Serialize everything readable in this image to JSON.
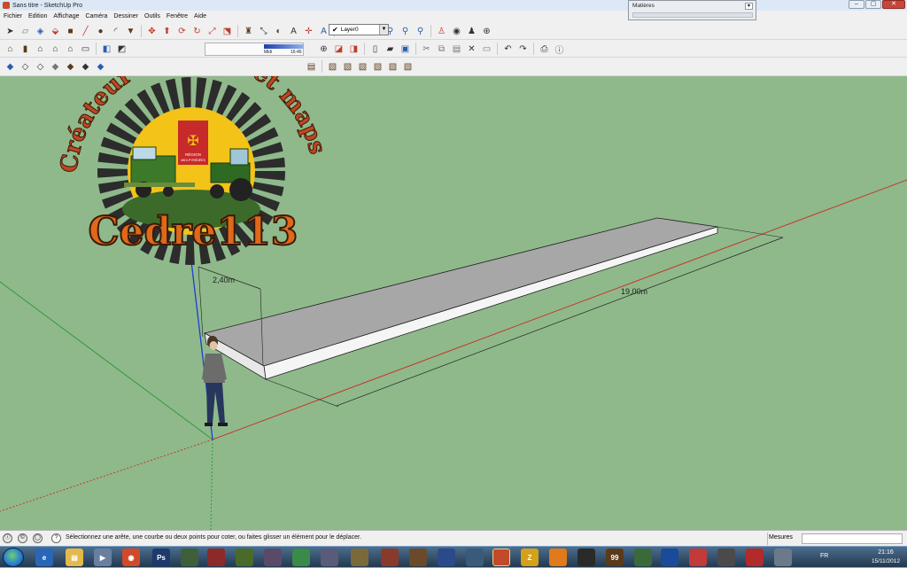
{
  "window": {
    "title": "Sans titre - SketchUp Pro",
    "min": "–",
    "max": "▢",
    "close": "✕"
  },
  "menu": [
    "Fichier",
    "Edition",
    "Affichage",
    "Caméra",
    "Dessiner",
    "Outils",
    "Fenêtre",
    "Aide"
  ],
  "layer": {
    "value": "Layer0",
    "check": "✔"
  },
  "shadow": {
    "noon": "Midi",
    "time": "16:46"
  },
  "materials": {
    "title": "Matières",
    "btn": "▾"
  },
  "dimensions": {
    "width": "2,40m",
    "length": "19,00m"
  },
  "logo": {
    "arc_text": "Créateur de mods et maps",
    "name": "Cedre113",
    "region_line1": "RÉGION",
    "region_line2": "MIDI-PYRÉNÉES"
  },
  "status": {
    "hint_icon": "?",
    "message": "Sélectionnez une arête, une courbe ou deux points pour coter, ou faites glisser un élément pour le déplacer.",
    "measures_label": "Mesures"
  },
  "taskbar": {
    "lang": "FR",
    "time": "21:16",
    "date": "15/11/2012",
    "apps": [
      "e",
      "▤",
      "▶",
      "◉",
      "Ps",
      "",
      "",
      "",
      "",
      "",
      "",
      "",
      "",
      "",
      "",
      "",
      "",
      "",
      "",
      "Z",
      "",
      "",
      "99",
      "",
      "",
      "",
      "",
      "",
      "",
      "",
      ""
    ]
  },
  "icons": {
    "toolbar1": [
      "select-arrow-icon",
      "eraser-icon",
      "make-component-icon",
      "paint-bucket-icon",
      "rectangle-icon",
      "line-icon",
      "circle-icon",
      "arc-icon",
      "polygon-icon",
      "move-icon",
      "push-pull-icon",
      "rotate-icon",
      "follow-me-icon",
      "scale-icon",
      "offset-icon",
      "tape-measure-icon",
      "dimension-icon",
      "protractor-icon",
      "text-icon",
      "axes-icon",
      "3d-text-icon",
      "orbit-icon",
      "pan-icon",
      "zoom-icon",
      "zoom-window-icon",
      "zoom-extents-icon",
      "previous-view-icon",
      "position-camera-icon",
      "walk-icon",
      "look-around-icon",
      "section-plane-icon"
    ]
  }
}
